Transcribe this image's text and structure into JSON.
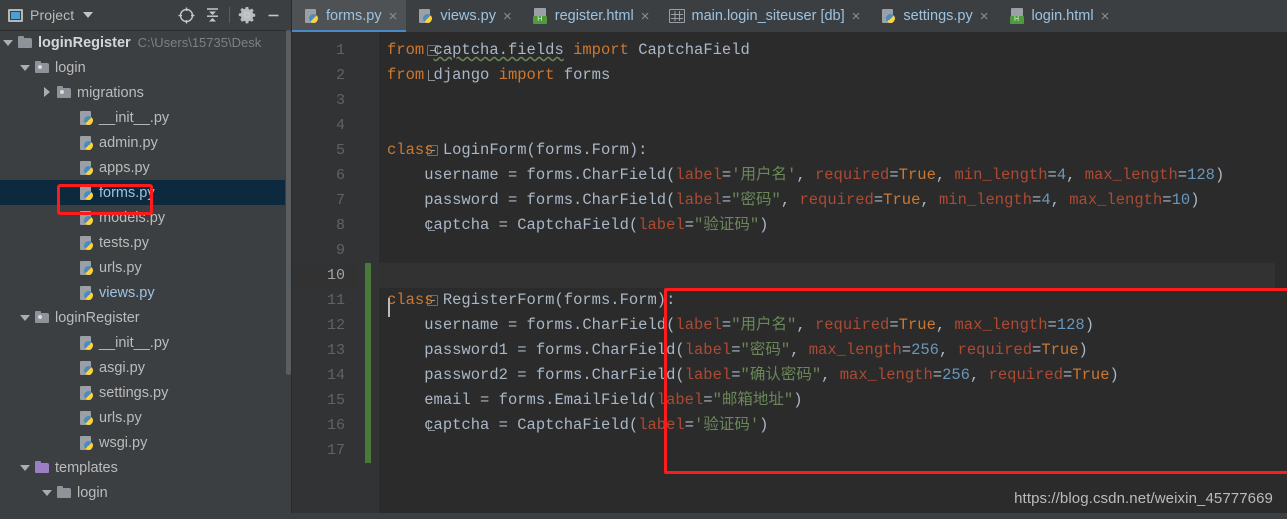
{
  "project_panel": {
    "title": "Project",
    "icons": {
      "window_icon": "project-window-icon",
      "dropdown": "chevron-down-icon",
      "locate": "target-locate-icon",
      "collapse_all": "collapse-all-icon",
      "settings": "gear-icon",
      "hide": "minimize-icon"
    },
    "tree": [
      {
        "label": "loginRegister",
        "path": "C:\\Users\\15735\\Desk",
        "icon": "folder-icon",
        "arrow": "down",
        "indent": 0,
        "style": "bold",
        "selected": false
      },
      {
        "label": "login",
        "path": "",
        "icon": "module-folder-icon",
        "arrow": "down",
        "indent": 1,
        "style": "normal",
        "selected": false
      },
      {
        "label": "migrations",
        "path": "",
        "icon": "module-folder-icon",
        "arrow": "right",
        "indent": 2,
        "style": "normal",
        "selected": false
      },
      {
        "label": "__init__.py",
        "path": "",
        "icon": "python-file-icon",
        "arrow": "none",
        "indent": 3,
        "style": "normal",
        "selected": false
      },
      {
        "label": "admin.py",
        "path": "",
        "icon": "python-file-icon",
        "arrow": "none",
        "indent": 3,
        "style": "normal",
        "selected": false
      },
      {
        "label": "apps.py",
        "path": "",
        "icon": "python-file-icon",
        "arrow": "none",
        "indent": 3,
        "style": "normal",
        "selected": false
      },
      {
        "label": "forms.py",
        "path": "",
        "icon": "python-file-icon",
        "arrow": "none",
        "indent": 3,
        "style": "blue",
        "selected": true
      },
      {
        "label": "models.py",
        "path": "",
        "icon": "python-file-icon",
        "arrow": "none",
        "indent": 3,
        "style": "normal",
        "selected": false
      },
      {
        "label": "tests.py",
        "path": "",
        "icon": "python-file-icon",
        "arrow": "none",
        "indent": 3,
        "style": "normal",
        "selected": false
      },
      {
        "label": "urls.py",
        "path": "",
        "icon": "python-file-icon",
        "arrow": "none",
        "indent": 3,
        "style": "normal",
        "selected": false
      },
      {
        "label": "views.py",
        "path": "",
        "icon": "python-file-icon",
        "arrow": "none",
        "indent": 3,
        "style": "blue",
        "selected": false
      },
      {
        "label": "loginRegister",
        "path": "",
        "icon": "module-folder-icon",
        "arrow": "down",
        "indent": 1,
        "style": "normal",
        "selected": false
      },
      {
        "label": "__init__.py",
        "path": "",
        "icon": "python-file-icon",
        "arrow": "none",
        "indent": 3,
        "style": "normal",
        "selected": false
      },
      {
        "label": "asgi.py",
        "path": "",
        "icon": "python-file-icon",
        "arrow": "none",
        "indent": 3,
        "style": "normal",
        "selected": false
      },
      {
        "label": "settings.py",
        "path": "",
        "icon": "python-file-icon",
        "arrow": "none",
        "indent": 3,
        "style": "normal",
        "selected": false
      },
      {
        "label": "urls.py",
        "path": "",
        "icon": "python-file-icon",
        "arrow": "none",
        "indent": 3,
        "style": "normal",
        "selected": false
      },
      {
        "label": "wsgi.py",
        "path": "",
        "icon": "python-file-icon",
        "arrow": "none",
        "indent": 3,
        "style": "normal",
        "selected": false
      },
      {
        "label": "templates",
        "path": "",
        "icon": "resource-folder-icon",
        "arrow": "down",
        "indent": 1,
        "style": "normal",
        "selected": false
      },
      {
        "label": "login",
        "path": "",
        "icon": "folder-icon",
        "arrow": "down",
        "indent": 2,
        "style": "normal",
        "selected": false
      }
    ]
  },
  "tabs": [
    {
      "label": "forms.py",
      "icon": "python-file-icon",
      "active": true,
      "close": "×"
    },
    {
      "label": "views.py",
      "icon": "python-file-icon",
      "active": false,
      "close": "×"
    },
    {
      "label": "register.html",
      "icon": "html-file-icon",
      "active": false,
      "close": "×"
    },
    {
      "label": "main.login_siteuser [db]",
      "icon": "database-table-icon",
      "active": false,
      "close": "×"
    },
    {
      "label": "settings.py",
      "icon": "python-file-icon",
      "active": false,
      "close": "×"
    },
    {
      "label": "login.html",
      "icon": "html-file-icon",
      "active": false,
      "close": "×"
    }
  ],
  "editor": {
    "current_line": 10,
    "line_numbers": [
      1,
      2,
      3,
      4,
      5,
      6,
      7,
      8,
      9,
      10,
      11,
      12,
      13,
      14,
      15,
      16,
      17
    ],
    "code_lines": [
      "from captcha.fields import CaptchaField",
      "from django import forms",
      "",
      "",
      "class LoginForm(forms.Form):",
      "    username = forms.CharField(label='用户名', required=True, min_length=4, max_length=128)",
      "    password = forms.CharField(label=\"密码\", required=True, min_length=4, max_length=10)",
      "    captcha = CaptchaField(label=\"验证码\")",
      "",
      "",
      "class RegisterForm(forms.Form):",
      "    username = forms.CharField(label=\"用户名\", required=True, max_length=128)",
      "    password1 = forms.CharField(label=\"密码\", max_length=256, required=True)",
      "    password2 = forms.CharField(label=\"确认密码\", max_length=256, required=True)",
      "    email = forms.EmailField(label=\"邮箱地址\")",
      "    captcha = CaptchaField(label='验证码')",
      ""
    ],
    "tokens": {
      "from": "from",
      "import": "import",
      "class": "class",
      "captcha_fields": "captcha.fields",
      "CaptchaField": "CaptchaField",
      "django": "django",
      "forms": "forms",
      "LoginForm": "LoginForm",
      "RegisterForm": "RegisterForm",
      "formsForm": "forms.Form",
      "username": "username",
      "password": "password",
      "password1": "password1",
      "password2": "password2",
      "email": "email",
      "captcha_var": "captcha",
      "CharField": "forms.CharField",
      "EmailField": "forms.EmailField",
      "label": "label",
      "required": "required",
      "min_length": "min_length",
      "max_length": "max_length",
      "True": "True",
      "s_username_sq": "'用户名'",
      "s_username_dq": "\"用户名\"",
      "s_password": "\"密码\"",
      "s_confirm": "\"确认密码\"",
      "s_email": "\"邮箱地址\"",
      "s_captcha_dq": "\"验证码\"",
      "s_captcha_sq": "'验证码'",
      "n4": "4",
      "n10": "10",
      "n128": "128",
      "n256": "256"
    }
  },
  "annotations": {
    "highlight_color": "#ff1b1b",
    "file_box": "forms.py",
    "code_box": "RegisterForm class block"
  },
  "watermark": {
    "text": "https://blog.csdn.net/weixin_45777669"
  },
  "colors": {
    "background": "#3c3f41",
    "editor_background": "#2b2b2b",
    "selection": "#0d293e",
    "keyword": "#cc7832",
    "string": "#6a8759",
    "number": "#6897bb",
    "param": "#ac4a32",
    "text": "#a9b7c6",
    "accent": "#4a88c7",
    "vcs_added": "#4a7a3a"
  }
}
